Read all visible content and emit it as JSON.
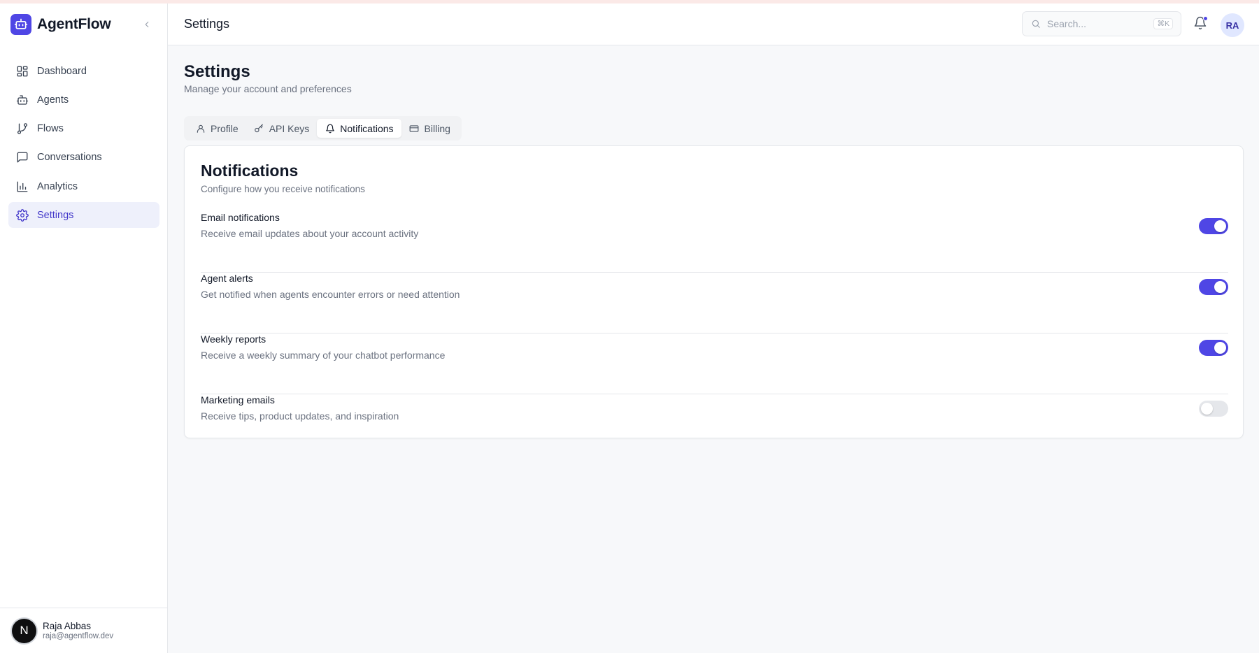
{
  "app": {
    "name": "AgentFlow",
    "accent": "#4f46e5"
  },
  "sidebar": {
    "items": [
      {
        "label": "Dashboard",
        "icon": "dashboard-icon",
        "active": false
      },
      {
        "label": "Agents",
        "icon": "bot-icon",
        "active": false
      },
      {
        "label": "Flows",
        "icon": "git-branch-icon",
        "active": false
      },
      {
        "label": "Conversations",
        "icon": "message-square-icon",
        "active": false
      },
      {
        "label": "Analytics",
        "icon": "bar-chart-icon",
        "active": false
      },
      {
        "label": "Settings",
        "icon": "gear-icon",
        "active": true
      }
    ],
    "user": {
      "initial": "N",
      "name": "Raja Abbas",
      "email": "raja@agentflow.dev"
    }
  },
  "header": {
    "title": "Settings",
    "search": {
      "placeholder": "Search...",
      "shortcut": "⌘K"
    },
    "avatar_initials": "RA"
  },
  "page": {
    "title": "Settings",
    "subtitle": "Manage your account and preferences"
  },
  "tabs": [
    {
      "label": "Profile",
      "icon": "user-icon",
      "active": false
    },
    {
      "label": "API Keys",
      "icon": "key-icon",
      "active": false
    },
    {
      "label": "Notifications",
      "icon": "bell-icon",
      "active": true
    },
    {
      "label": "Billing",
      "icon": "credit-card-icon",
      "active": false
    }
  ],
  "notifications": {
    "title": "Notifications",
    "description": "Configure how you receive notifications",
    "settings": [
      {
        "label": "Email notifications",
        "description": "Receive email updates about your account activity",
        "enabled": true
      },
      {
        "label": "Agent alerts",
        "description": "Get notified when agents encounter errors or need attention",
        "enabled": true
      },
      {
        "label": "Weekly reports",
        "description": "Receive a weekly summary of your chatbot performance",
        "enabled": true
      },
      {
        "label": "Marketing emails",
        "description": "Receive tips, product updates, and inspiration",
        "enabled": false
      }
    ]
  }
}
